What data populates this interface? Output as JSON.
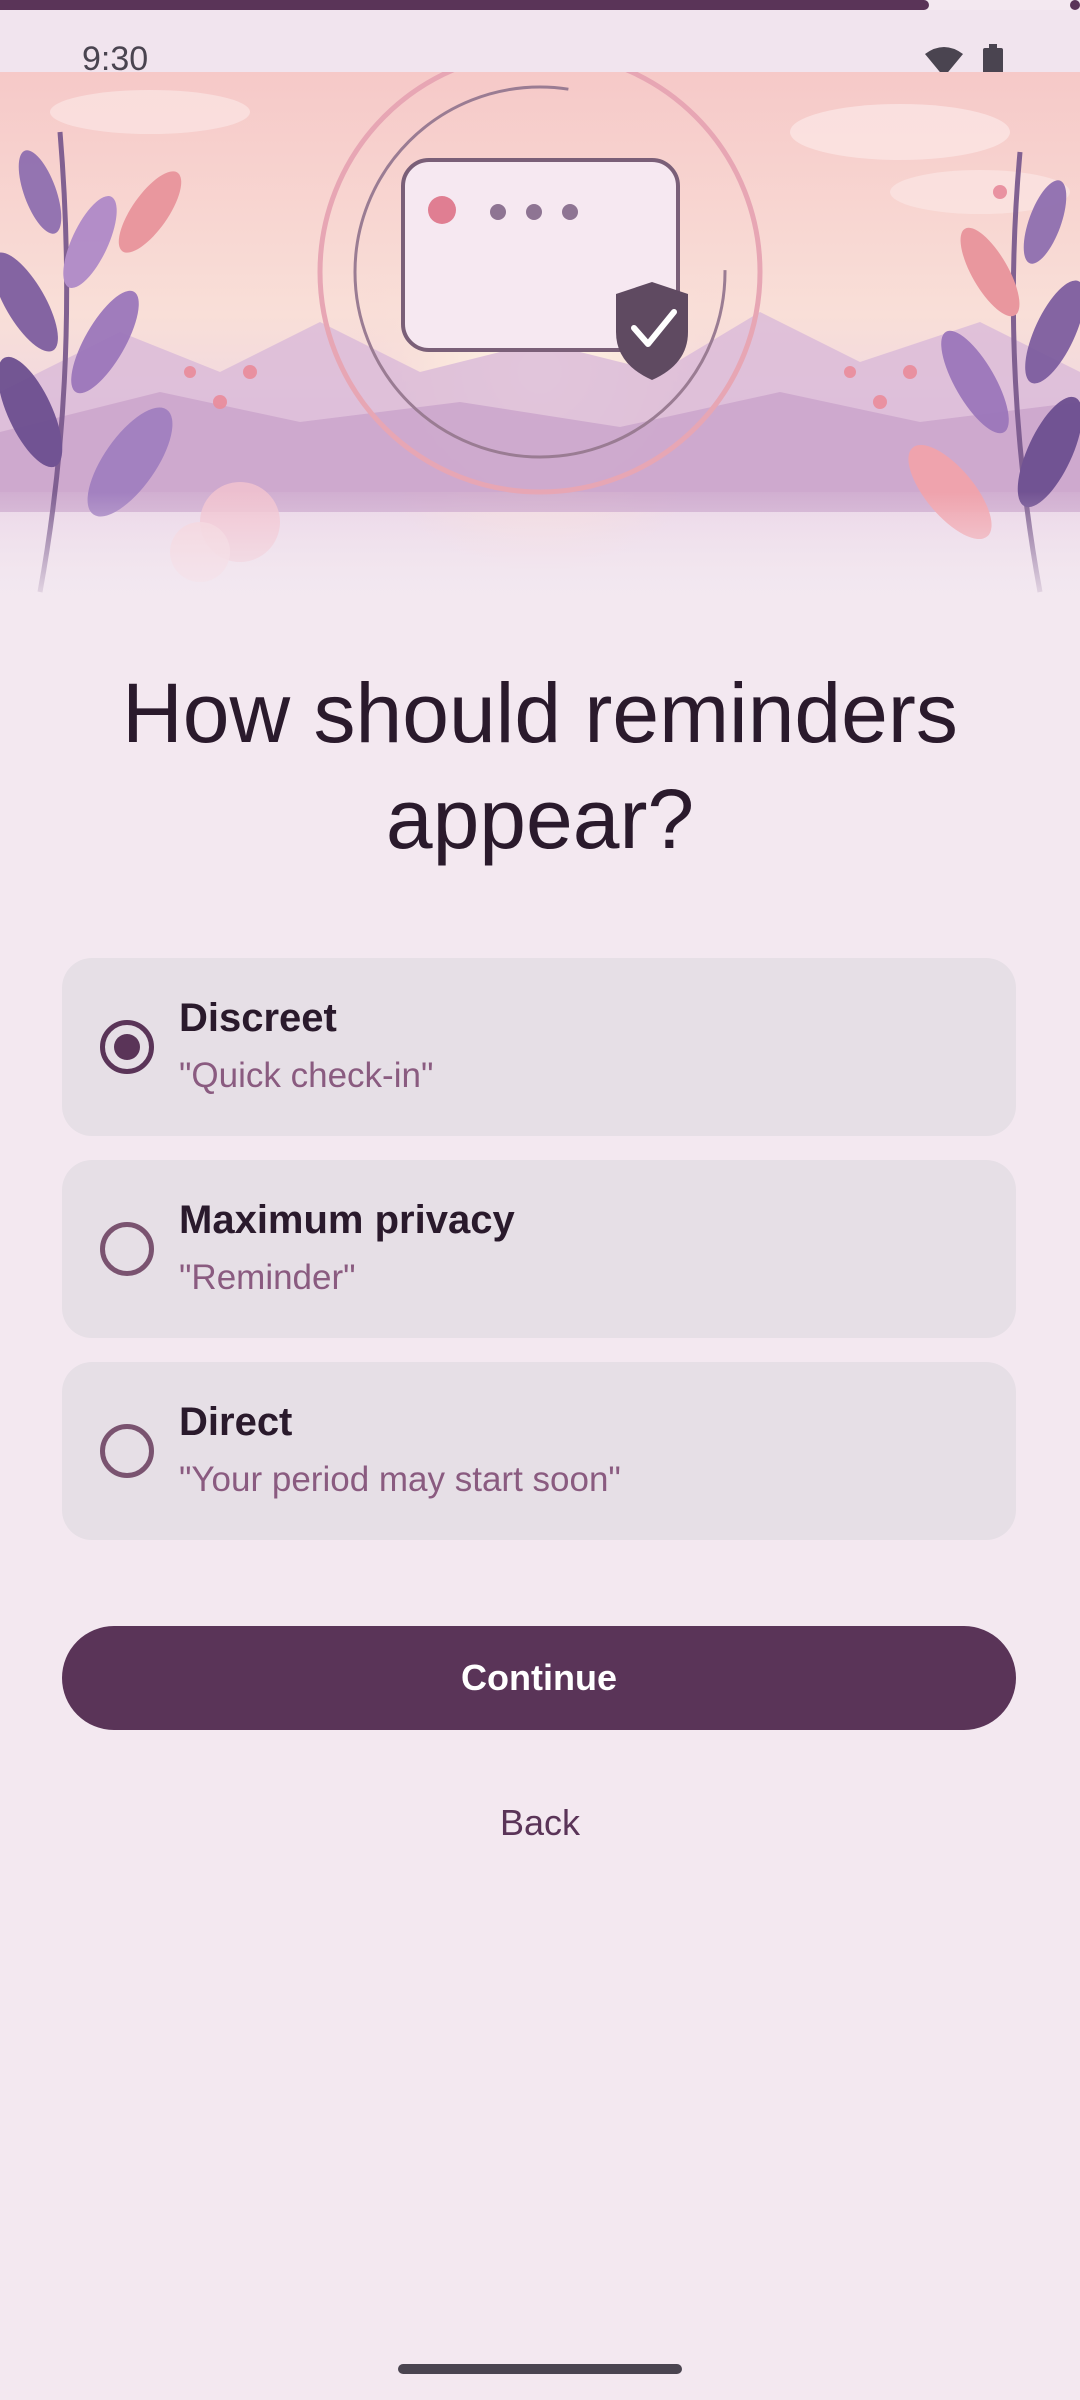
{
  "progress": {
    "fraction": 0.86
  },
  "status_bar": {
    "time": "9:30",
    "icons": [
      "wifi-icon",
      "battery-icon"
    ]
  },
  "hero": {
    "icons": [
      "notification-card-icon",
      "shield-check-icon"
    ]
  },
  "title": "How should reminders appear?",
  "options": [
    {
      "label": "Discreet",
      "example": "\"Quick check-in\"",
      "selected": true
    },
    {
      "label": "Maximum privacy",
      "example": "\"Reminder\"",
      "selected": false
    },
    {
      "label": "Direct",
      "example": "\"Your period may start soon\"",
      "selected": false
    }
  ],
  "buttons": {
    "continue": "Continue",
    "back": "Back"
  },
  "colors": {
    "background": "#f3e8f0",
    "primary": "#5a3458",
    "option_card": "#e6dfe6",
    "subtitle": "#8a5b80"
  }
}
